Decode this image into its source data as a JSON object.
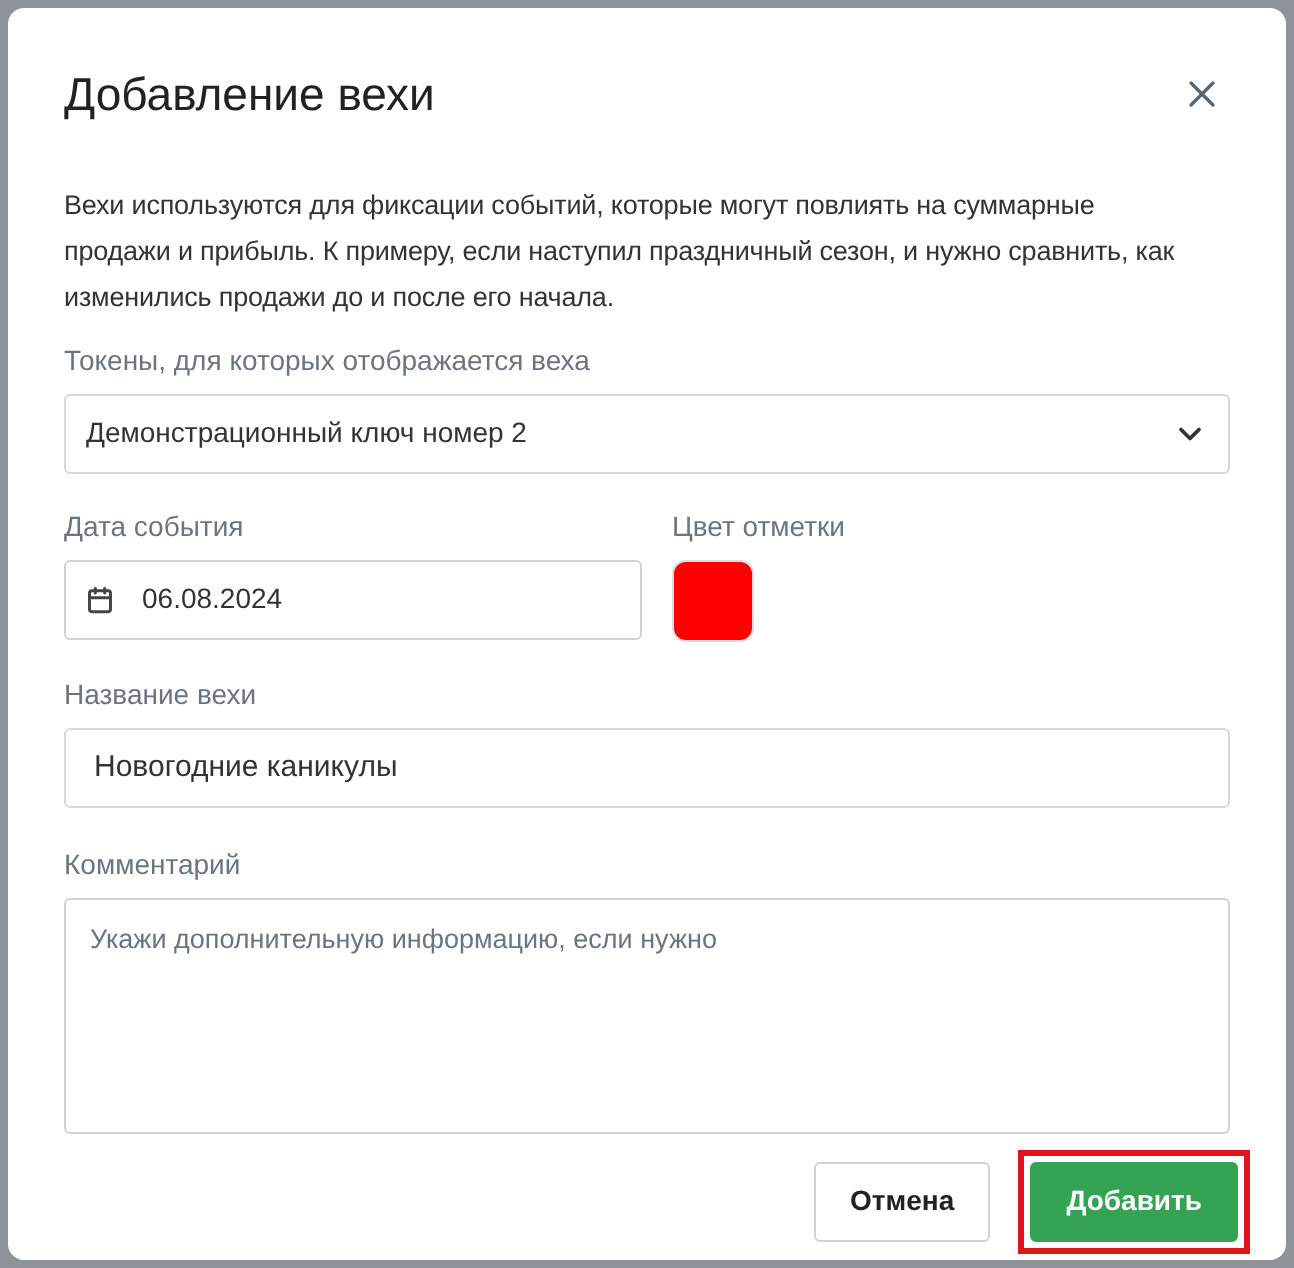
{
  "dialog": {
    "title": "Добавление вехи",
    "description": "Вехи используются для фиксации событий, которые могут повлиять на суммарные продажи и прибыль. К примеру, если наступил праздничный сезон, и нужно сравнить, как изменились продажи до и после его начала.",
    "tokens": {
      "label": "Токены, для которых отображается веха",
      "value": "Демонстрационный ключ номер 2"
    },
    "date": {
      "label": "Дата события",
      "value": "06.08.2024"
    },
    "marker_color": {
      "label": "Цвет отметки",
      "color": "#ff0000"
    },
    "name": {
      "label": "Название вехи",
      "value": "Новогодние каникулы"
    },
    "comment": {
      "label": "Комментарий",
      "placeholder": "Укажи дополнительную информацию, если нужно"
    },
    "buttons": [
      {
        "label": "Отмена",
        "kind": "secondary",
        "highlighted": false
      },
      {
        "label": "Добавить",
        "kind": "primary",
        "highlighted": true
      }
    ]
  }
}
